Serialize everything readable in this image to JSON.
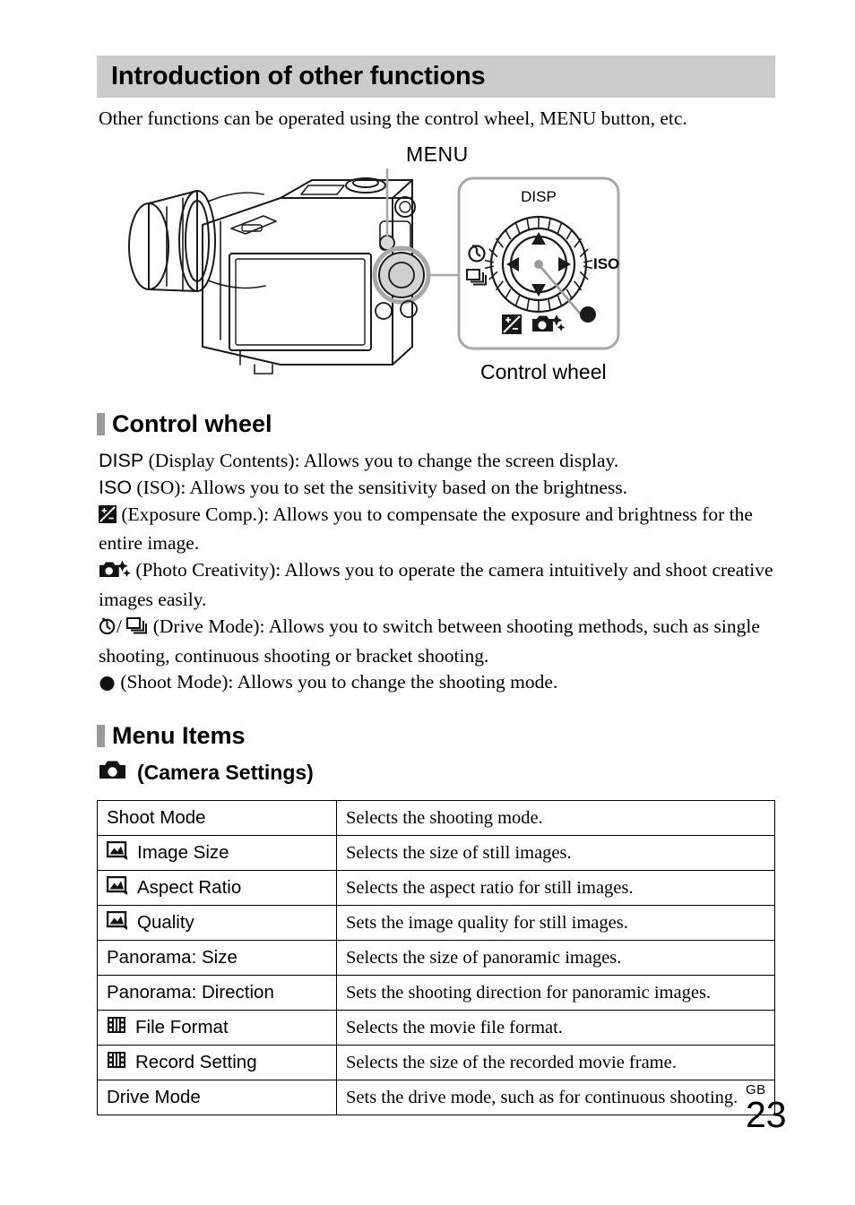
{
  "header": {
    "title": "Introduction of other functions",
    "band_color": "#cbcbcb"
  },
  "intro": {
    "text": "Other functions can be operated using the control wheel, MENU button, etc."
  },
  "figure": {
    "menu_callout": "MENU",
    "wheel_caption": "Control wheel",
    "wheel_labels": {
      "top": "DISP",
      "right": "ISO"
    }
  },
  "sections": {
    "control_wheel_heading": "Control wheel",
    "menu_items_heading": "Menu Items",
    "camera_settings_label": "(Camera Settings)"
  },
  "control_wheel_entries": [
    {
      "icon": "disp-text",
      "key_text": "DISP",
      "name": "(Display Contents):",
      "description": " Allows you to change the screen display."
    },
    {
      "icon": "iso-text",
      "key_text": "ISO",
      "name": "(ISO):",
      "description": " Allows you to set the sensitivity based on the brightness."
    },
    {
      "icon": "exposure-comp-icon",
      "key_text": "",
      "name": "(Exposure Comp.):",
      "description": " Allows you to compensate the exposure and brightness for the entire image."
    },
    {
      "icon": "photo-creativity-icon",
      "key_text": "",
      "name": "(Photo Creativity):",
      "description": " Allows you to operate the camera intuitively and shoot creative images easily."
    },
    {
      "icon": "drive-mode-icons",
      "key_text": "",
      "name": "(Drive Mode):",
      "description": " Allows you to switch between shooting methods, such as single shooting, continuous shooting or bracket shooting."
    },
    {
      "icon": "shoot-mode-dot-icon",
      "key_text": "",
      "name": "(Shoot Mode):",
      "description": " Allows you to change the shooting mode."
    }
  ],
  "menu_table": {
    "rows": [
      {
        "icon": "none",
        "item": "Shoot Mode",
        "description": "Selects the shooting mode."
      },
      {
        "icon": "still-image-icon",
        "item": "Image Size",
        "description": "Selects the size of still images."
      },
      {
        "icon": "still-image-icon",
        "item": "Aspect Ratio",
        "description": "Selects the aspect ratio for still images."
      },
      {
        "icon": "still-image-icon",
        "item": "Quality",
        "description": "Sets the image quality for still images."
      },
      {
        "icon": "none",
        "item": "Panorama: Size",
        "description": "Selects the size of panoramic images."
      },
      {
        "icon": "none",
        "item": "Panorama: Direction",
        "description": "Sets the shooting direction for panoramic images."
      },
      {
        "icon": "movie-film-icon",
        "item": "File Format",
        "description": "Selects the movie file format."
      },
      {
        "icon": "movie-film-icon",
        "item": "Record Setting",
        "description": "Selects the size of the recorded movie frame."
      },
      {
        "icon": "none",
        "item": "Drive Mode",
        "description": "Sets the drive mode, such as for continuous shooting."
      }
    ]
  },
  "footer": {
    "region_code": "GB",
    "page_number": "23"
  }
}
